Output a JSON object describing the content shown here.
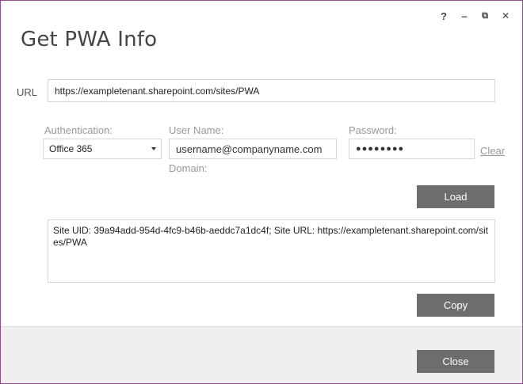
{
  "window": {
    "title": "Get PWA Info",
    "controls": {
      "help": "?",
      "minimize": "–",
      "restore": "⧉",
      "close": "✕"
    }
  },
  "url": {
    "label": "URL",
    "value": "https://exampletenant.sharepoint.com/sites/PWA"
  },
  "auth": {
    "label": "Authentication:",
    "selected": "Office 365"
  },
  "username": {
    "label": "User Name:",
    "value": "username@companyname.com"
  },
  "password": {
    "label": "Password:",
    "value": "●●●●●●●●",
    "clear_label": "Clear"
  },
  "domain": {
    "label": "Domain:"
  },
  "load_label": "Load",
  "output": {
    "text": "Site UID: 39a94add-954d-4fc9-b46b-aeddc7a1dc4f; Site URL: https://exampletenant.sharepoint.com/sites/PWA"
  },
  "copy_label": "Copy",
  "close_label": "Close",
  "colors": {
    "frame": "#8e4a8c",
    "button": "#6d6d6d",
    "footer": "#f0eff0"
  }
}
